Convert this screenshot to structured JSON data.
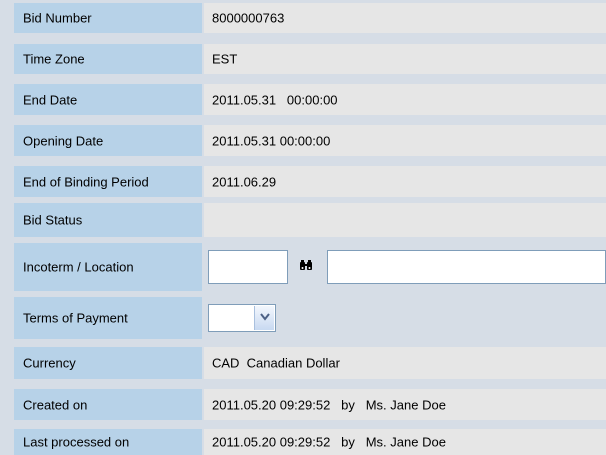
{
  "form": {
    "rows": [
      {
        "label": "Bid Number",
        "value": "8000000763"
      },
      {
        "label": "Time Zone",
        "value": "EST"
      },
      {
        "label": "End Date",
        "value": "2011.05.31   00:00:00"
      },
      {
        "label": "Opening Date",
        "value": "2011.05.31 00:00:00"
      },
      {
        "label": "End of Binding Period",
        "value": "2011.06.29"
      },
      {
        "label": "Bid Status",
        "value": ""
      },
      {
        "label": "Incoterm / Location",
        "incoterm_value": "",
        "location_value": ""
      },
      {
        "label": "Terms of Payment",
        "selected": ""
      },
      {
        "label": "Currency",
        "value": "CAD  Canadian Dollar"
      },
      {
        "label": "Created on",
        "value": "2011.05.20 09:29:52   by   Ms. Jane Doe"
      },
      {
        "label": "Last processed on",
        "value": "2011.05.20 09:29:52   by   Ms. Jane Doe"
      }
    ]
  },
  "icons": {
    "search_help": "binoculars-icon",
    "dropdown": "chevron-down-icon"
  },
  "colors": {
    "label_bg": "#b7d2e8",
    "value_bg": "#e6e6e6",
    "page_bg": "#d6dde6"
  }
}
